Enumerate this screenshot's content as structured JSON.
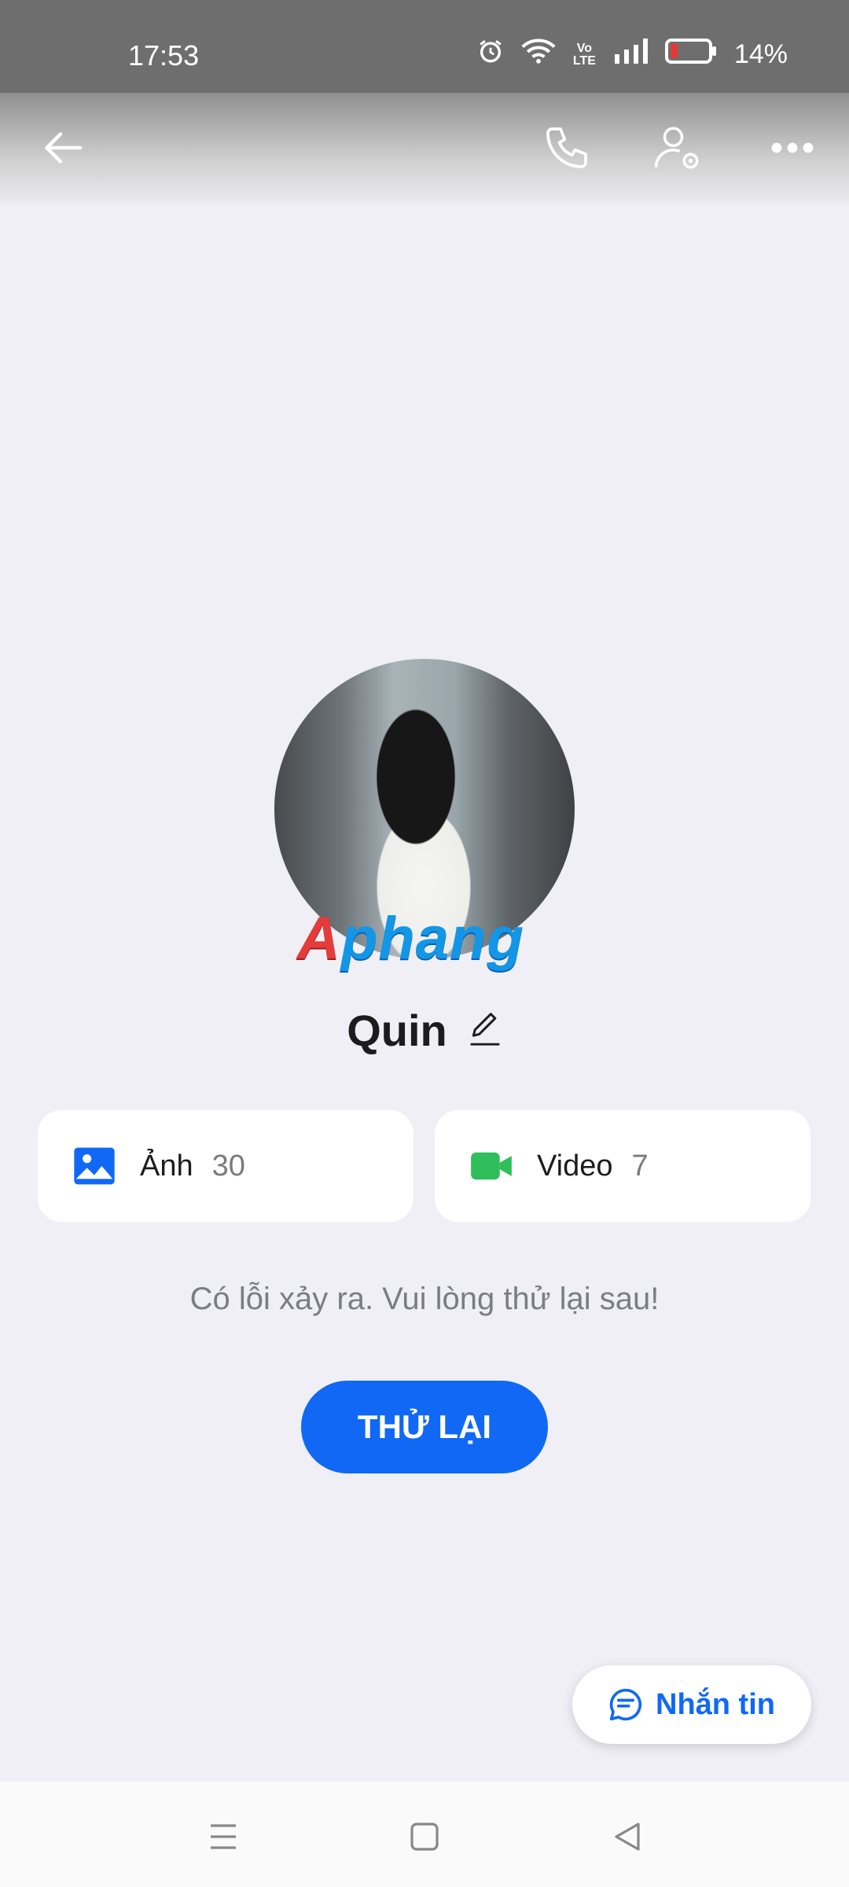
{
  "status_bar": {
    "time": "17:53",
    "battery": "14%"
  },
  "profile": {
    "name": "Quin",
    "watermark_red": "A",
    "watermark_blue": "phang"
  },
  "cards": [
    {
      "label": "Ảnh",
      "count": "30",
      "icon": "image-icon",
      "color": "#1068f5"
    },
    {
      "label": "Video",
      "count": "7",
      "icon": "video-icon",
      "color": "#2fbf5a"
    }
  ],
  "error": {
    "message": "Có lỗi xảy ra. Vui lòng thử lại sau!",
    "retry_label": "THỬ LẠI"
  },
  "chat_button": {
    "label": "Nhắn tin"
  },
  "colors": {
    "accent": "#1068f5",
    "background": "#efeff5"
  }
}
